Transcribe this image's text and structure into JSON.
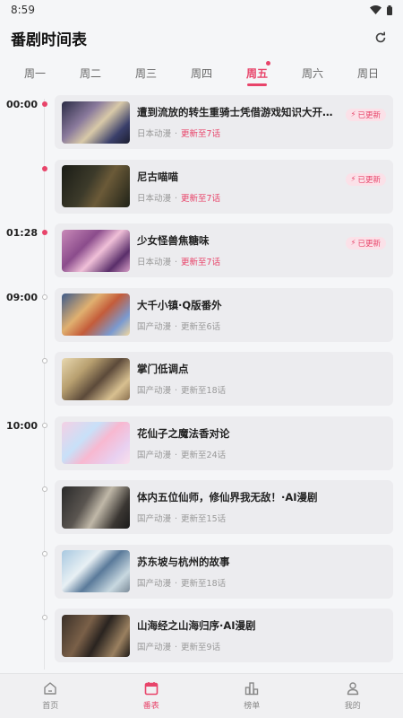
{
  "status_bar": {
    "time": "8:59"
  },
  "header": {
    "title": "番剧时间表"
  },
  "tabs": [
    {
      "label": "周一",
      "active": false
    },
    {
      "label": "周二",
      "active": false
    },
    {
      "label": "周三",
      "active": false
    },
    {
      "label": "周四",
      "active": false
    },
    {
      "label": "周五",
      "active": true
    },
    {
      "label": "周六",
      "active": false
    },
    {
      "label": "周日",
      "active": false
    }
  ],
  "updated_badge": "已更新",
  "schedule": [
    {
      "time": "00:00",
      "title": "遭到流放的转生重骑士凭借游戏知识大开无双",
      "category": "日本动漫",
      "episode": "更新至7话",
      "updated": true
    },
    {
      "time": "",
      "title": "尼古喵喵",
      "category": "日本动漫",
      "episode": "更新至7话",
      "updated": true
    },
    {
      "time": "01:28",
      "title": "少女怪兽焦糖味",
      "category": "日本动漫",
      "episode": "更新至7话",
      "updated": true
    },
    {
      "time": "09:00",
      "title": "大千小镇·Q版番外",
      "category": "国产动漫",
      "episode": "更新至6话",
      "updated": false
    },
    {
      "time": "",
      "title": "掌门低调点",
      "category": "国产动漫",
      "episode": "更新至18话",
      "updated": false
    },
    {
      "time": "10:00",
      "title": "花仙子之魔法香对论",
      "category": "国产动漫",
      "episode": "更新至24话",
      "updated": false
    },
    {
      "time": "",
      "title": "体内五位仙师，修仙界我无敌！·AI漫剧",
      "category": "国产动漫",
      "episode": "更新至15话",
      "updated": false
    },
    {
      "time": "",
      "title": "苏东坡与杭州的故事",
      "category": "国产动漫",
      "episode": "更新至18话",
      "updated": false
    },
    {
      "time": "",
      "title": "山海经之山海归序·AI漫剧",
      "category": "国产动漫",
      "episode": "更新至9话",
      "updated": false
    }
  ],
  "bottom_nav": [
    {
      "label": "首页",
      "icon": "home-icon",
      "active": false
    },
    {
      "label": "番表",
      "icon": "calendar-icon",
      "active": true
    },
    {
      "label": "榜单",
      "icon": "chart-icon",
      "active": false
    },
    {
      "label": "我的",
      "icon": "user-icon",
      "active": false
    }
  ],
  "colors": {
    "accent": "#e8446a",
    "background": "#f5f6f8",
    "card": "#ececef"
  }
}
